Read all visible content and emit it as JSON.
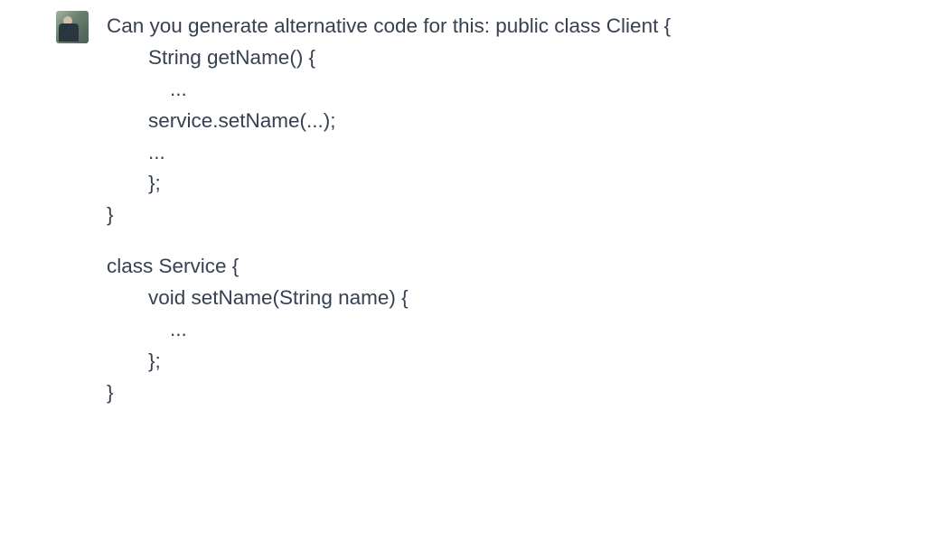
{
  "message": {
    "lines": [
      "Can you generate alternative code for this: public class Client {",
      "String getName() {",
      "...",
      "service.setName(...);",
      "...",
      "};",
      "}",
      "",
      "class Service {",
      "void setName(String name) {",
      "...",
      "};",
      "}"
    ]
  }
}
